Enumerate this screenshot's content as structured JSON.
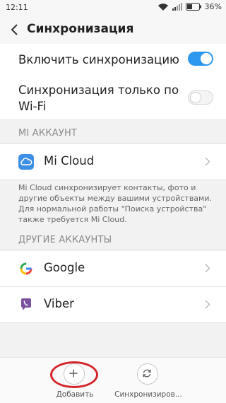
{
  "status_bar": {
    "time": "12:11",
    "battery": "36%"
  },
  "header": {
    "title": "Синхронизация"
  },
  "toggles": [
    {
      "label": "Включить синхронизацию",
      "state": "on"
    },
    {
      "label_line1": "Синхронизация только по",
      "label_line2": "Wi-Fi",
      "state": "off"
    }
  ],
  "mi_account": {
    "section_title": "MI АККАУНТ",
    "item_label": "Mi Cloud",
    "description_lines": [
      "Mi Cloud синхронизирует контакты, фото и",
      "другие объекты между вашими устройствами.",
      "Для нормальной работы \"Поиска устройства\"",
      "также требуется Mi Cloud."
    ]
  },
  "other_accounts": {
    "section_title": "ДРУГИЕ АККАУНТЫ",
    "items": [
      {
        "label": "Google",
        "icon": "google-icon"
      },
      {
        "label": "Viber",
        "icon": "viber-icon"
      }
    ]
  },
  "bottom_bar": {
    "add_label": "Добавить",
    "sync_label": "Синхронизиров..."
  },
  "colors": {
    "accent": "#2e97f0",
    "annotation": "#d4262a",
    "mi_cloud": "#3d8fe6",
    "viber": "#7b519d"
  }
}
